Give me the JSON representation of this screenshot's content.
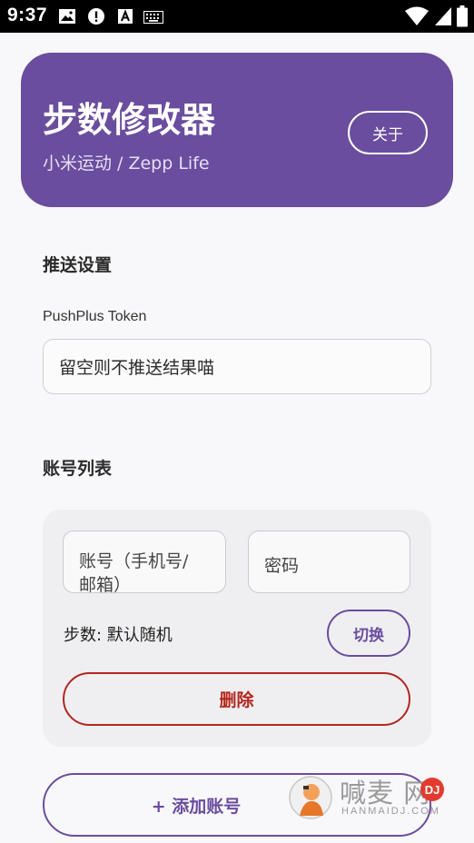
{
  "status_bar": {
    "time": "9:37",
    "icons": [
      "image-icon",
      "alert-icon",
      "text-icon",
      "keyboard-icon",
      "wifi-icon",
      "battery-icon"
    ]
  },
  "header": {
    "title": "步数修改器",
    "subtitle": "小米运动 / Zepp Life",
    "about_label": "关于"
  },
  "push_settings": {
    "section_title": "推送设置",
    "token_label": "PushPlus Token",
    "token_placeholder": "留空则不推送结果喵"
  },
  "accounts": {
    "section_title": "账号列表",
    "items": [
      {
        "account_placeholder_line1": "账号（手机号/",
        "account_placeholder_line2": "邮箱）",
        "password_placeholder": "密码",
        "steps_text": "步数: 默认随机",
        "switch_label": "切换",
        "delete_label": "删除"
      }
    ],
    "add_label": "+ 添加账号"
  },
  "watermark": {
    "text": "喊麦 网",
    "dj": "DJ",
    "sub": "HANMAIDJ.COM"
  },
  "colors": {
    "primary": "#6a4d9e",
    "danger": "#b3261e",
    "background": "#f8f7f9",
    "card": "#efeff1"
  }
}
